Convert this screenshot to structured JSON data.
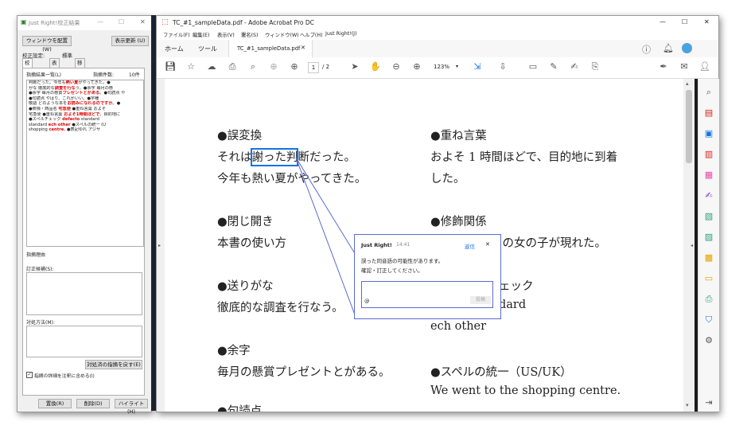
{
  "just_right": {
    "title": "Just Right!校正結果",
    "arrange_button": "ウィンドウを配置 (W)",
    "refresh_button": "表示更新 (U)",
    "setting_label": "校正設定:",
    "setting_value": "標準",
    "tabs": [
      "校正結果",
      "表記ゆれ",
      "移張"
    ],
    "list_label": "指摘結果一覧(L)",
    "count_label": "指摘件数:",
    "count_value": "10件",
    "list_lines": [
      {
        "pre": "判断だった。今年も",
        "red": "熱い夏",
        "post": "がやってきた。●"
      },
      {
        "pre": "がな 徹底的な",
        "red": "調査を行な",
        "post": "う。●余字 毎月の懸"
      },
      {
        "pre": " ●余字 毎月の懸賞",
        "red": "プレゼントとがある",
        "post": "。●句読点 や"
      },
      {
        "pre": "   ●句読点 やはり、これがいい。●字種",
        "red": "",
        "post": ""
      },
      {
        "pre": "敬語 どのような本を",
        "red": "お読みになれるのですか",
        "post": "。●"
      },
      {
        "pre": "   ●商標・商品名 ",
        "red": "宅急便",
        "post": " ●重ね言葉 およそ"
      },
      {
        "pre": "宅急便 ●重ね言葉 ",
        "red": "およそ1時間ほどで",
        "post": "、目的地に"
      },
      {
        "pre": " ●スペルチェック ",
        "red": "defacto",
        "post": " standard"
      },
      {
        "pre": "standard ",
        "red": "ech other",
        "post": " ●スペルの統一 (U"
      },
      {
        "pre": "shopping ",
        "red": "centre.",
        "post": " ●表記ゆれ アジサ"
      }
    ],
    "reason_label": "指摘理由",
    "candidates_label": "訂正候補(S):",
    "method_label": "対処方法(M):",
    "restore_button": "対処済の指摘を戻す(E)",
    "checkbox_label": "指摘の詳細を注釈に含める(I)",
    "replace_button": "置換(R)",
    "delete_button": "削除(D)",
    "highlight_button": "ハイライト(H)"
  },
  "acrobat": {
    "title": "TC_#1_sampleData.pdf - Adobe Acrobat Pro DC",
    "menu": [
      "ファイル(F)",
      "編集(E)",
      "表示(V)",
      "署名(S)",
      "ウィンドウ(W)",
      "ヘルプ(H)",
      "Just Right!(J)"
    ],
    "home_tab": "ホーム",
    "tools_tab": "ツール",
    "doc_tab": "TC_#1_sampleData.pdf",
    "page_current": "1",
    "page_total": "/ 2",
    "zoom": "123%",
    "document": {
      "left": [
        {
          "heading": "●誤変換",
          "lines": [
            "それは謝った判断だった。",
            "今年も熱い夏がやってきた。"
          ]
        },
        {
          "heading": "●閉じ開き",
          "lines": [
            "本書の使い方"
          ]
        },
        {
          "heading": "●送りがな",
          "lines": [
            "徹底的な調査を行なう。"
          ]
        },
        {
          "heading": "●余字",
          "lines": [
            "毎月の懸賞プレゼントとがある。"
          ]
        },
        {
          "heading": "●句読点",
          "lines": []
        }
      ],
      "right": [
        {
          "heading": "●重ね言葉",
          "lines": [
            "およそ 1 時間ほどで、目的地に到着",
            "した。"
          ]
        },
        {
          "heading": "●修飾関係",
          "lines": [
            "目の女の子が現れた。"
          ]
        },
        {
          "heading": "ェック",
          "lines": [
            "dard",
            "ech other"
          ]
        },
        {
          "heading": "●スペルの統一（US/UK）",
          "lines": [
            "We went to the shopping centre."
          ]
        }
      ]
    },
    "comment": {
      "author": "Just Right!",
      "time": "14:41",
      "reply": "返信",
      "message": [
        "誤った同音語の可能性があります。",
        "確認・訂正してください。"
      ],
      "at": "@",
      "post": "投稿"
    }
  }
}
